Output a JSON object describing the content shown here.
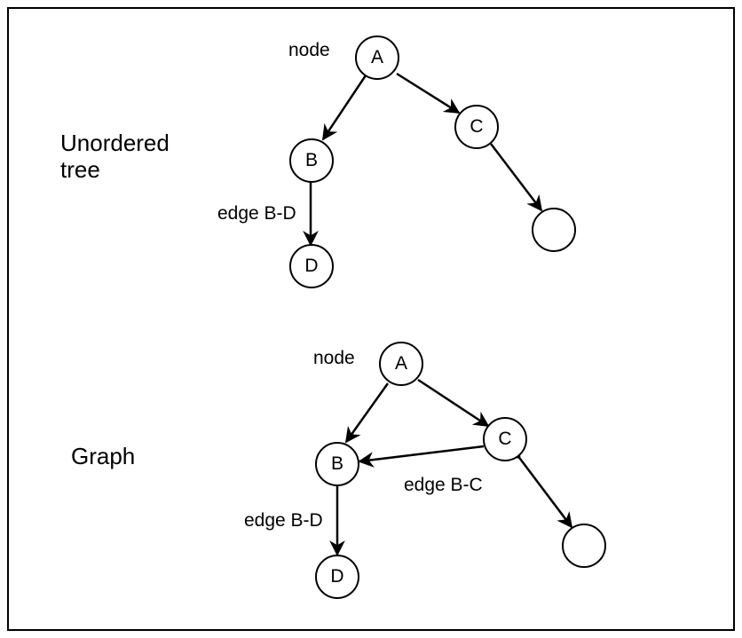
{
  "tree": {
    "title": "Unordered\ntree",
    "node_label": "node",
    "edge_bd_label": "edge B-D",
    "A": "A",
    "B": "B",
    "C": "C",
    "D": "D"
  },
  "graph": {
    "title": "Graph",
    "node_label": "node",
    "edge_bd_label": "edge B-D",
    "edge_bc_label": "edge B-C",
    "A": "A",
    "B": "B",
    "C": "C",
    "D": "D"
  }
}
